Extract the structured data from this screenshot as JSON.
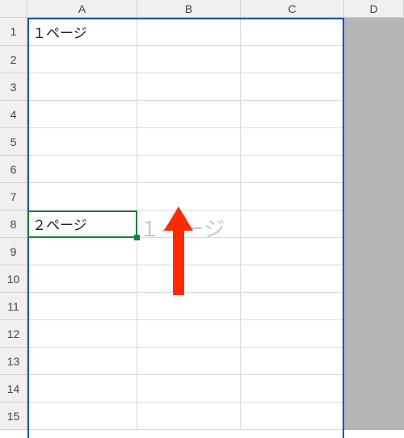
{
  "columns": [
    "A",
    "B",
    "C",
    "D"
  ],
  "rowCount": 15,
  "cells": {
    "A1": "１ページ",
    "A8": "２ページ"
  },
  "watermark": {
    "text": "１ページ"
  },
  "activeCell": "A8",
  "annotation": {
    "type": "arrow-up",
    "color": "#ff2a00"
  }
}
